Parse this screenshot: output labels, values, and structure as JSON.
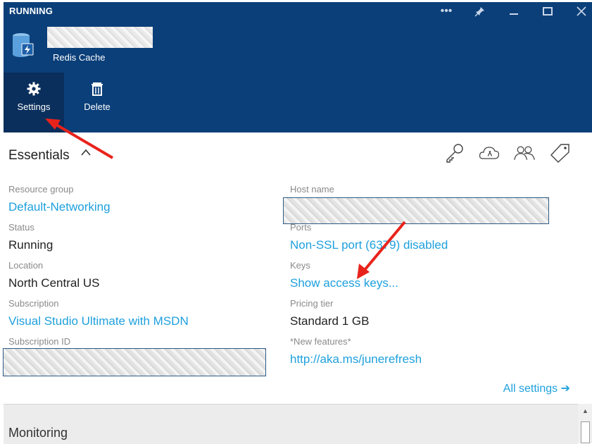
{
  "header": {
    "status": "RUNNING",
    "subtitle": "Redis Cache",
    "window_controls": [
      "more-icon",
      "pin-icon",
      "minimize-icon",
      "maximize-icon",
      "close-icon"
    ],
    "commands": [
      {
        "label": "Settings",
        "icon": "gear-icon"
      },
      {
        "label": "Delete",
        "icon": "trash-icon"
      }
    ]
  },
  "essentials": {
    "title": "Essentials",
    "toolbar_icons": [
      "key-icon",
      "cloud-icon",
      "users-icon",
      "tag-icon"
    ],
    "left": [
      {
        "label": "Resource group",
        "value": "Default-Networking",
        "link": true
      },
      {
        "label": "Status",
        "value": "Running",
        "link": false
      },
      {
        "label": "Location",
        "value": "North Central US",
        "link": false
      },
      {
        "label": "Subscription",
        "value": "Visual Studio Ultimate with MSDN",
        "link": true
      },
      {
        "label": "Subscription ID",
        "value": "",
        "link": false
      }
    ],
    "right": [
      {
        "label": "Host name",
        "value": "",
        "link": false
      },
      {
        "label": "Ports",
        "value": "Non-SSL port (6379) disabled",
        "link": true
      },
      {
        "label": "Keys",
        "value": "Show access keys...",
        "link": true
      },
      {
        "label": "Pricing tier",
        "value": "Standard 1 GB",
        "link": false
      },
      {
        "label": "*New features*",
        "value": "http://aka.ms/junerefresh",
        "link": true
      }
    ],
    "all_settings": "All settings ➔"
  },
  "monitoring": {
    "title": "Monitoring"
  },
  "colors": {
    "header_bg": "#0b3f79",
    "link": "#1ea0dd",
    "arrow": "#e8231c"
  }
}
